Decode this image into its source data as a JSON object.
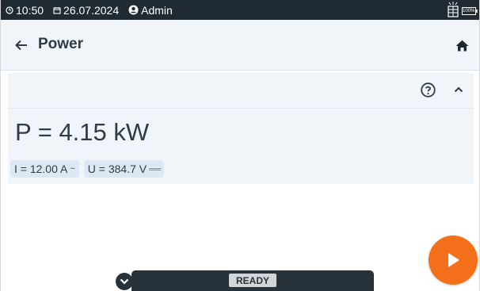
{
  "status_bar": {
    "time": "10:50",
    "date": "26.07.2024",
    "user": "Admin",
    "battery_label": "100%"
  },
  "header": {
    "title": "Power"
  },
  "measurement": {
    "main_value": "P = 4.15 kW",
    "current": "I = 12.00 A",
    "current_suffix": "~",
    "voltage": "U = 384.7 V",
    "voltage_suffix": "═══"
  },
  "bottom": {
    "status": "READY"
  },
  "colors": {
    "status_bar_bg": "#1f2a33",
    "header_bg": "#f0f5fa",
    "chip_bg": "#dce9f5",
    "play_button": "#f46f1a",
    "bottom_bar_bg": "#27323a"
  },
  "icons": {
    "clock": "clock-icon",
    "calendar": "calendar-icon",
    "user": "account-circle-icon",
    "device": "device-icon",
    "battery": "battery-icon",
    "back": "arrow-left-icon",
    "home": "home-icon",
    "help": "help-circle-icon",
    "collapse": "chevron-up-icon",
    "expand": "chevron-down-circle-icon",
    "play": "play-icon"
  }
}
